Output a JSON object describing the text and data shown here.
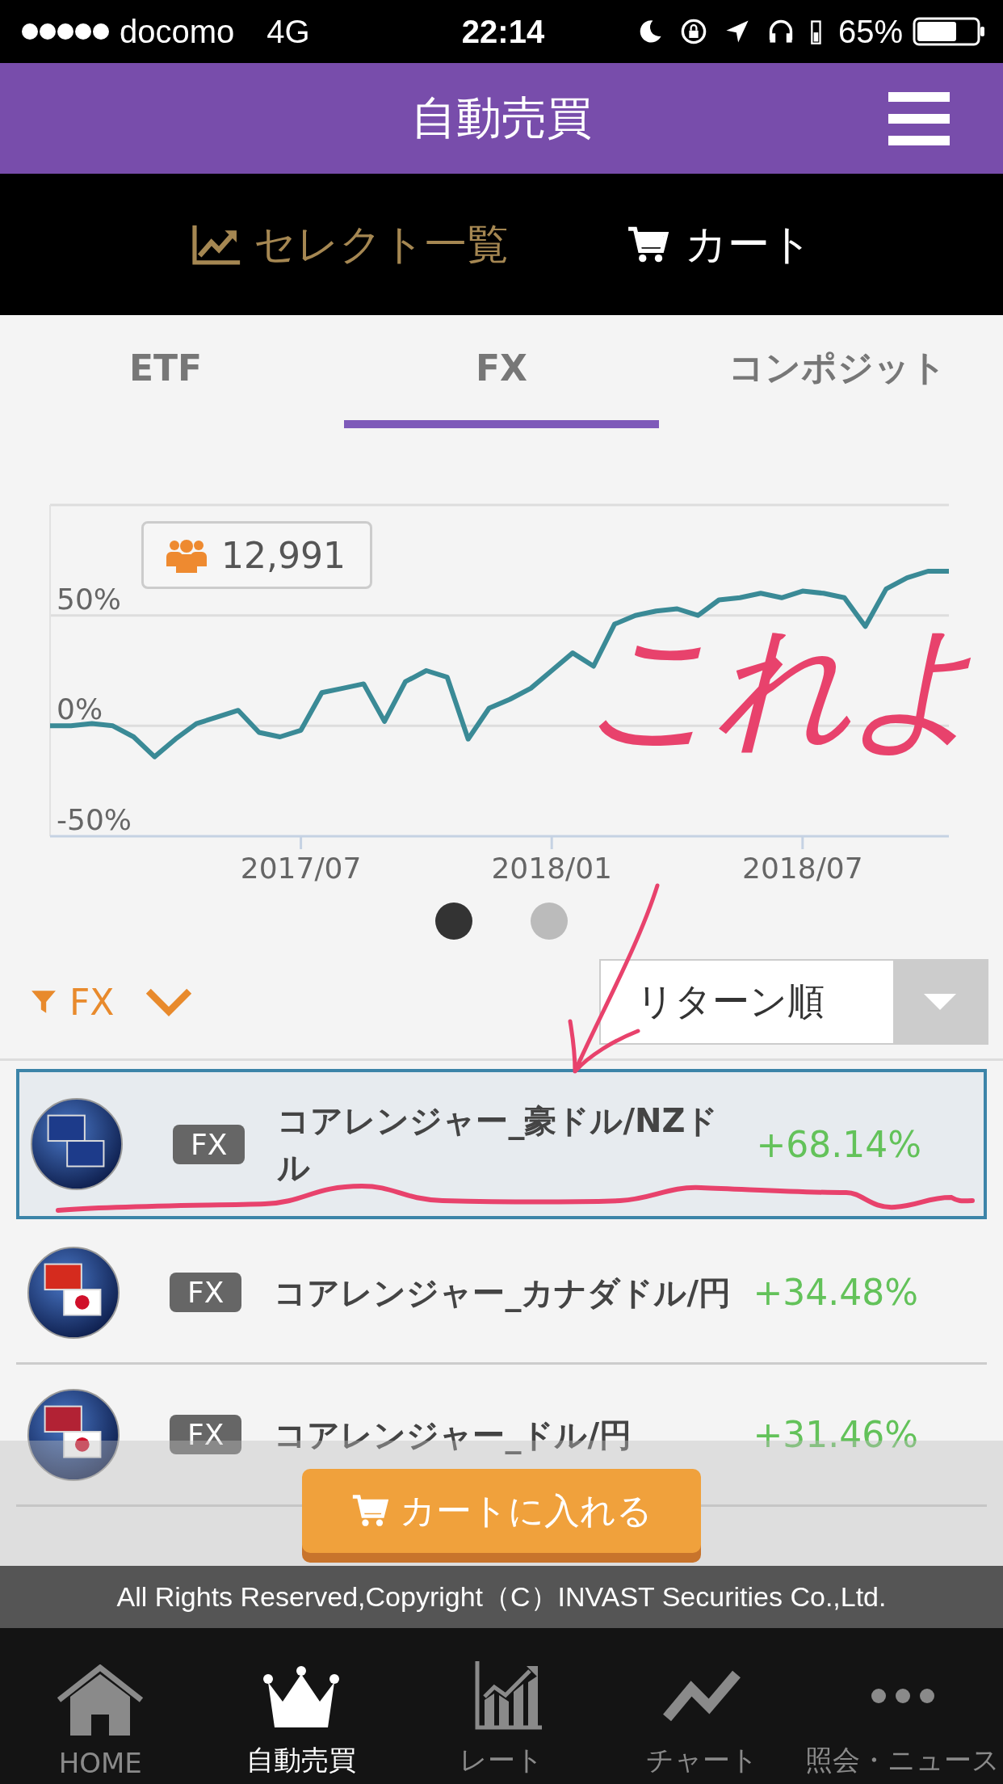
{
  "status_bar": {
    "carrier": "docomo",
    "network": "4G",
    "time": "22:14",
    "battery": "65%"
  },
  "header": {
    "title": "自動売買"
  },
  "subnav": [
    {
      "label": "セレクト一覧",
      "selected": true
    },
    {
      "label": "カート",
      "selected": false
    }
  ],
  "tabs": [
    {
      "label": "ETF",
      "selected": false
    },
    {
      "label": "FX",
      "selected": true
    },
    {
      "label": "コンポジット",
      "selected": false
    }
  ],
  "chart": {
    "badge_count": "12,991",
    "chart_data": {
      "type": "line",
      "categories": [
        null,
        null,
        null,
        null,
        null,
        null,
        null,
        null,
        null,
        null,
        null,
        null,
        "2017/07",
        null,
        null,
        null,
        null,
        null,
        null,
        null,
        null,
        null,
        null,
        null,
        "2018/01",
        null,
        null,
        null,
        null,
        null,
        null,
        null,
        null,
        null,
        null,
        null,
        "2018/07",
        null,
        null,
        null,
        null,
        null,
        null,
        null
      ],
      "ylim": [
        -50,
        100
      ],
      "series": [
        {
          "color": "#3a8a96",
          "values": [
            0,
            0,
            1,
            0,
            -5,
            -14,
            -6,
            1,
            4,
            7,
            -3,
            -5,
            -2,
            15,
            17,
            19,
            2,
            20,
            25,
            22,
            -6,
            8,
            12,
            17,
            25,
            33,
            27,
            46,
            50,
            52,
            53,
            50,
            57,
            58,
            60,
            58,
            61,
            60,
            58,
            45,
            62,
            67,
            70,
            70
          ]
        }
      ],
      "yticks": [
        {
          "value": -50,
          "label": "-50%"
        },
        {
          "value": 0,
          "label": "0%"
        },
        {
          "value": 50,
          "label": "50%"
        }
      ]
    }
  },
  "carousel": [
    {
      "selected": true
    },
    {
      "selected": false
    }
  ],
  "filter": {
    "label": "FX"
  },
  "sort": {
    "value": "リターン順"
  },
  "rows": [
    {
      "tag": "FX",
      "name": "コアレンジャー_豪ドル/NZドル",
      "return": "+68.14%",
      "selected": true
    },
    {
      "tag": "FX",
      "name": "コアレンジャー_カナダドル/円",
      "return": "+34.48%",
      "selected": false
    },
    {
      "tag": "FX",
      "name": "コアレンジャー_ドル/円",
      "return": "+31.46%",
      "selected": false
    }
  ],
  "cart_button": {
    "label": "カートに入れる"
  },
  "copyright": "All Rights Reserved,Copyright（C）INVAST Securities Co.,Ltd.",
  "nav": [
    {
      "label": "HOME",
      "selected": false
    },
    {
      "label": "自動売買",
      "selected": true
    },
    {
      "label": "レート",
      "selected": false
    },
    {
      "label": "チャート",
      "selected": false
    },
    {
      "label": "照会・ニュース",
      "selected": false
    }
  ],
  "annotation": {
    "text": "これよ"
  }
}
